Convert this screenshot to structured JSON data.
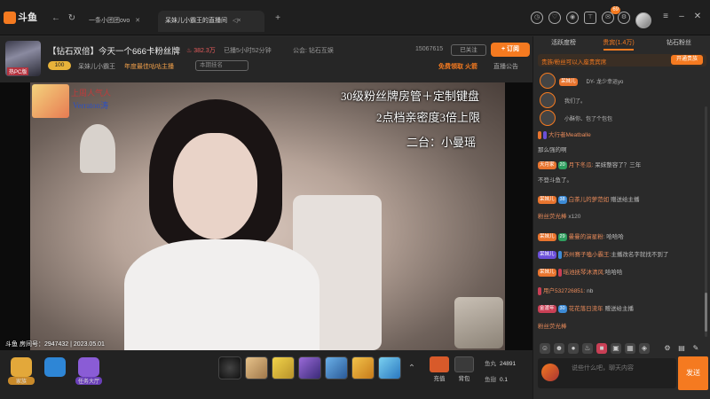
{
  "app": {
    "logo": "斗鱼"
  },
  "tabs": [
    {
      "label": "一条小团团ovo",
      "close": "✕"
    },
    {
      "label": "呆妹儿小霸王的直播间",
      "close": "◁×"
    }
  ],
  "titlebar": {
    "badge": "69"
  },
  "room": {
    "avatar_label": "热PC版",
    "title": "【钻石双倍】今天一个666卡粉丝牌",
    "heat": "382.3万",
    "live_time": "已播5小时52分钟",
    "guild": "公会: 钻石互娱",
    "level": "100",
    "streamer": "呆妹儿小霸王",
    "category": "年度最佳咕咕主播",
    "input_placeholder": "本期挂名",
    "room_id": "15067615",
    "follow": "已关注",
    "subscribe": "+ 订阅",
    "fan_free": "免费领取",
    "fan_fire": "火箭",
    "notice": "直播公告"
  },
  "video": {
    "overlay_line1": "30级粉丝牌房管＋定制键盘",
    "overlay_line2": "2点档亲密度3倍上限",
    "overlay_line3": "二台：小曼瑶",
    "sticker_line1": "上周人气人",
    "sticker_line2": "Verraton涛",
    "watermark": "斗鱼 房间号：2947432 | 2023.05.01"
  },
  "bottombar": {
    "btn1": "家族",
    "btn2": "",
    "btn3": "任务大厅",
    "recharge": "充值",
    "backpack": "背包",
    "fish_ball_label": "鱼丸",
    "fish_ball": "24891",
    "fish_fin_label": "鱼翅",
    "fish_fin": "0.1"
  },
  "right": {
    "tabs": [
      "活跃度榜",
      "贵宾(1.4万)",
      "钻石粉丝"
    ],
    "vip_text": "贵族/粉丝可以入座贵宾席",
    "vip_btn": "开通贵族",
    "top_rows": [
      {
        "badge": "呆妹儿",
        "text": "DY- 龙少幸运yo"
      },
      {
        "badge": "",
        "text": "我们了。"
      },
      {
        "badge": "",
        "text": "小酥你、包了个包包"
      }
    ],
    "messages": [
      {
        "b1": "",
        "b2": "",
        "nick": "大行者Meatballe",
        "text": ""
      },
      {
        "b1": "",
        "b2": "",
        "nick": "",
        "text": "那么强的啊"
      },
      {
        "b1": "天月家",
        "b2": "20",
        "nick": "月下冬瓜:",
        "text": "呆妹整容了？三年"
      },
      {
        "b1": "",
        "b2": "",
        "nick": "",
        "text": "不登斗鱼了。"
      },
      {
        "b1": "呆妹儿",
        "b2": "38",
        "nick": "白茶儿的萝范如",
        "text": "赠送给主播"
      },
      {
        "b1": "",
        "b2": "",
        "nick": "粉丝荧光棒",
        "text": "x120"
      },
      {
        "b1": "呆妹儿",
        "b2": "29",
        "nick": "曼曼的演星粉:",
        "text": "哈哈哈"
      },
      {
        "b1": "呆妹儿",
        "b2": "",
        "nick": "苏州赛子嗑小霸王:",
        "text": "主播改名字就找不到了"
      },
      {
        "b1": "呆妹儿",
        "b2": "",
        "nick": "瑶池抚琴沐清风:",
        "text": "哈哈哈"
      },
      {
        "b1": "",
        "b2": "",
        "nick": "用户532726851:",
        "text": "nb"
      },
      {
        "b1": "金渡年",
        "b2": "30",
        "nick": "花花落日流年",
        "text": "赠送给主播"
      },
      {
        "b1": "",
        "b2": "",
        "nick": "粉丝荧光棒",
        "text": ""
      }
    ],
    "input_placeholder": "说些什么吧，聊天内容",
    "send": "发送"
  }
}
